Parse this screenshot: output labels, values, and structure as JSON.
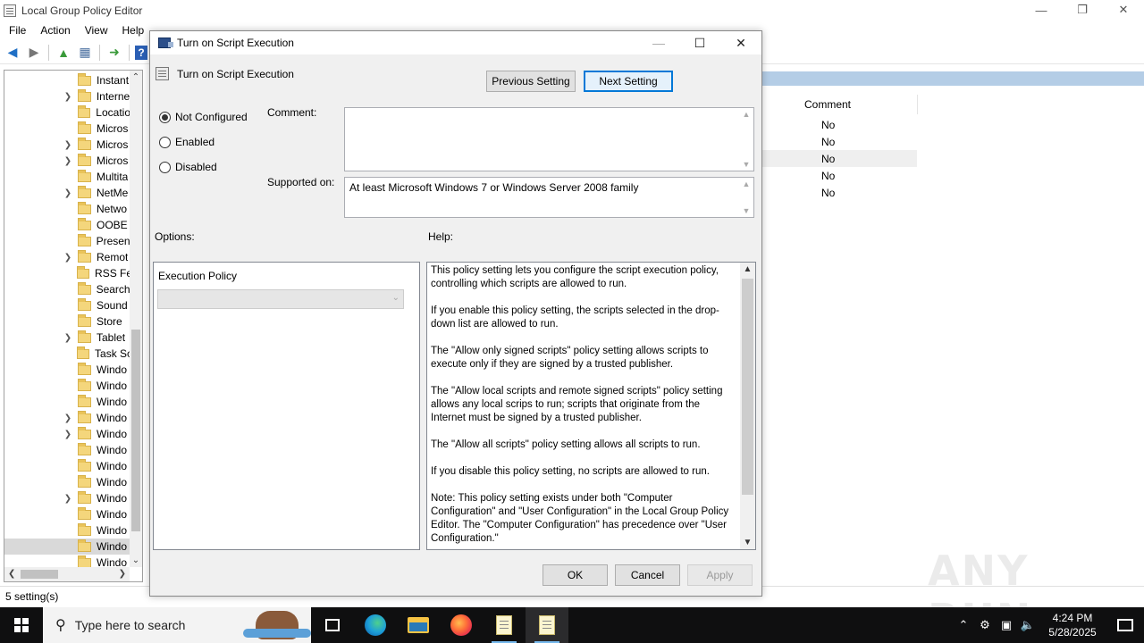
{
  "main": {
    "title": "Local Group Policy Editor",
    "controls": {
      "minimize": "—",
      "restore": "❐",
      "close": "✕"
    },
    "menu": [
      "File",
      "Action",
      "View",
      "Help"
    ],
    "tree_items": [
      {
        "label": "Instant",
        "expandable": false
      },
      {
        "label": "Interne",
        "expandable": true
      },
      {
        "label": "Locatio",
        "expandable": false
      },
      {
        "label": "Micros",
        "expandable": false
      },
      {
        "label": "Micros",
        "expandable": true
      },
      {
        "label": "Micros",
        "expandable": true
      },
      {
        "label": "Multita",
        "expandable": false
      },
      {
        "label": "NetMe",
        "expandable": true
      },
      {
        "label": "Netwo",
        "expandable": false
      },
      {
        "label": "OOBE",
        "expandable": false
      },
      {
        "label": "Presen",
        "expandable": false
      },
      {
        "label": "Remot",
        "expandable": true
      },
      {
        "label": "RSS Fe",
        "expandable": false
      },
      {
        "label": "Search",
        "expandable": false
      },
      {
        "label": "Sound",
        "expandable": false
      },
      {
        "label": "Store",
        "expandable": false
      },
      {
        "label": "Tablet",
        "expandable": true
      },
      {
        "label": "Task Sc",
        "expandable": false
      },
      {
        "label": "Windo",
        "expandable": false
      },
      {
        "label": "Windo",
        "expandable": false
      },
      {
        "label": "Windo",
        "expandable": false
      },
      {
        "label": "Windo",
        "expandable": true
      },
      {
        "label": "Windo",
        "expandable": true
      },
      {
        "label": "Windo",
        "expandable": false
      },
      {
        "label": "Windo",
        "expandable": false
      },
      {
        "label": "Windo",
        "expandable": false
      },
      {
        "label": "Windo",
        "expandable": true
      },
      {
        "label": "Windo",
        "expandable": false
      },
      {
        "label": "Windo",
        "expandable": false
      },
      {
        "label": "Windo",
        "expandable": false,
        "selected": true
      },
      {
        "label": "Windo",
        "expandable": false
      }
    ],
    "list": {
      "column_header": "Comment",
      "rows": [
        "No",
        "No",
        "No",
        "No",
        "No"
      ],
      "highlight_row": 2
    },
    "status": "5 setting(s)"
  },
  "dialog": {
    "title": "Turn on Script Execution",
    "controls": {
      "minimize": "—",
      "maximize": "☐",
      "close": "✕"
    },
    "setting_name": "Turn on Script Execution",
    "previous_button": "Previous Setting",
    "next_button": "Next Setting",
    "radios": [
      {
        "label": "Not Configured",
        "checked": true
      },
      {
        "label": "Enabled",
        "checked": false
      },
      {
        "label": "Disabled",
        "checked": false
      }
    ],
    "comment_label": "Comment:",
    "comment_value": "",
    "supported_label": "Supported on:",
    "supported_value": "At least Microsoft Windows 7 or Windows Server 2008 family",
    "options_label": "Options:",
    "help_label": "Help:",
    "execution_policy_label": "Execution Policy",
    "execution_policy_value": "",
    "help_paragraphs": [
      "This policy setting lets you configure the script execution policy, controlling which scripts are allowed to run.",
      "If you enable this policy setting, the scripts selected in the drop-down list are allowed to run.",
      "The \"Allow only signed scripts\" policy setting allows scripts to execute only if they are signed by a trusted publisher.",
      "The \"Allow local scripts and remote signed scripts\" policy setting allows any local scrips to run; scripts that originate from the Internet must be signed by a trusted publisher.",
      "The \"Allow all scripts\" policy setting allows all scripts to run.",
      "If you disable this policy setting, no scripts are allowed to run.",
      "Note: This policy setting exists under both \"Computer Configuration\" and \"User Configuration\" in the Local Group Policy Editor. The \"Computer Configuration\" has precedence over \"User Configuration.\""
    ],
    "ok_button": "OK",
    "cancel_button": "Cancel",
    "apply_button": "Apply"
  },
  "watermark": "ANY RUN",
  "taskbar": {
    "search_placeholder": "Type here to search",
    "clock_time": "4:24 PM",
    "clock_date": "5/28/2025",
    "tray_icons": [
      "chevron-up-icon",
      "network-icon",
      "monitor-icon",
      "volume-icon"
    ]
  },
  "colors": {
    "accent": "#0078d7",
    "taskbar": "#0f0f10",
    "selection_band": "#b4cde6"
  }
}
